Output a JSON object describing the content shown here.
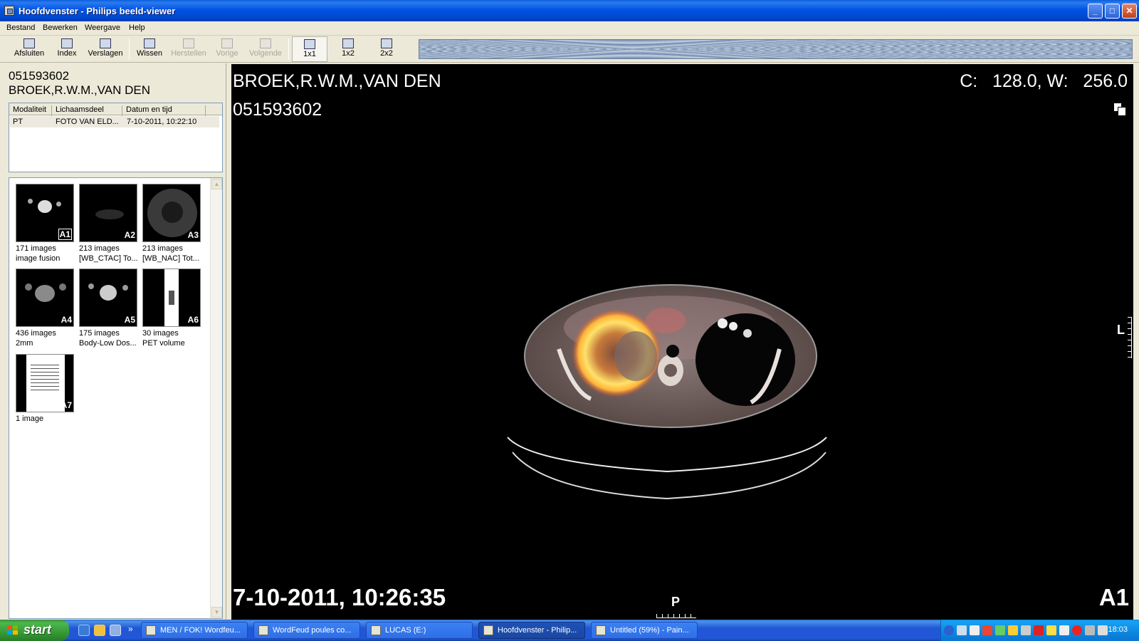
{
  "window": {
    "title": "Hoofdvenster - Philips beeld-viewer",
    "controls": [
      "minimize",
      "maximize",
      "close"
    ]
  },
  "menu": [
    "Bestand",
    "Bewerken",
    "Weergave",
    "Help"
  ],
  "toolbar": {
    "buttons": [
      {
        "label": "Afsluiten",
        "icon": "exit-icon",
        "enabled": true
      },
      {
        "label": "Index",
        "icon": "index-icon",
        "enabled": true
      },
      {
        "label": "Verslagen",
        "icon": "reports-icon",
        "enabled": true
      },
      {
        "label": "Wissen",
        "icon": "clear-icon",
        "enabled": true
      },
      {
        "label": "Herstellen",
        "icon": "restore-icon",
        "enabled": false
      },
      {
        "label": "Vorige",
        "icon": "previous-icon",
        "enabled": false
      },
      {
        "label": "Volgende",
        "icon": "next-icon",
        "enabled": false
      }
    ],
    "layouts": [
      {
        "label": "1x1",
        "selected": true
      },
      {
        "label": "1x2",
        "selected": false
      },
      {
        "label": "2x2",
        "selected": false
      }
    ]
  },
  "patient": {
    "id": "051593602",
    "name": "BROEK,R.W.M.,VAN DEN"
  },
  "studies": {
    "columns": [
      "Modaliteit",
      "Lichaamsdeel",
      "Datum en tijd"
    ],
    "rows": [
      {
        "modality": "PT",
        "bodypart": "FOTO VAN ELD...",
        "datetime": "7-10-2011, 10:22:10"
      }
    ]
  },
  "series": [
    {
      "tag": "A1",
      "count": "171 images",
      "desc": "image fusion",
      "selected": true
    },
    {
      "tag": "A2",
      "count": "213 images",
      "desc": "[WB_CTAC] To...",
      "selected": false
    },
    {
      "tag": "A3",
      "count": "213 images",
      "desc": "[WB_NAC] Tot...",
      "selected": false
    },
    {
      "tag": "A4",
      "count": "436 images",
      "desc": "2mm",
      "selected": false
    },
    {
      "tag": "A5",
      "count": "175 images",
      "desc": "Body-Low Dos...",
      "selected": false
    },
    {
      "tag": "A6",
      "count": "30 images",
      "desc": "PET volume",
      "selected": false
    },
    {
      "tag": "A7",
      "count": "1 image",
      "desc": "",
      "selected": false
    }
  ],
  "viewer": {
    "name": "BROEK,R.W.M.,VAN DEN",
    "id": "051593602",
    "center_width": "C:   128.0, W:   256.0",
    "datetime": "7-10-2011, 10:26:35",
    "series": "A1",
    "orientation_bottom": "P",
    "orientation_right": "L"
  },
  "taskbar": {
    "start": "start",
    "tasks": [
      {
        "label": "MEN / FOK! Wordfeu...",
        "active": false
      },
      {
        "label": "WordFeud poules co...",
        "active": false
      },
      {
        "label": "LUCAS (E:)",
        "active": false
      },
      {
        "label": "Hoofdvenster - Philip...",
        "active": true
      },
      {
        "label": "Untitled (59%) - Pain...",
        "active": false
      }
    ],
    "clock": "18:03"
  },
  "colors": {
    "titlebar": "#0054e3",
    "taskbar": "#2157d7",
    "start": "#3c9a3c",
    "viewer_bg": "#000000",
    "pet_hot": "#ffd84a"
  }
}
